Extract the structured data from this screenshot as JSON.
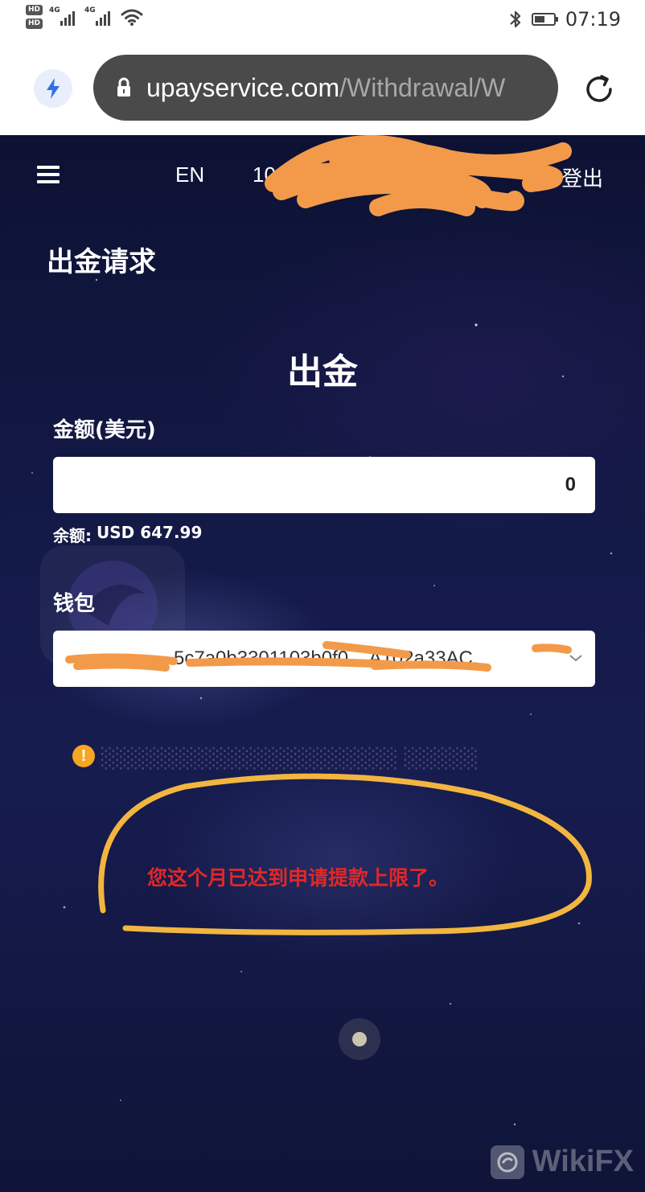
{
  "status_bar": {
    "badges": [
      "HD",
      "HD"
    ],
    "network_1": "4G",
    "network_2": "4G",
    "time": "07:19",
    "icons": [
      "bluetooth-icon",
      "battery-icon",
      "wifi-icon",
      "signal-icon"
    ],
    "battery_level": 0.55
  },
  "browser": {
    "url_domain": "upayservice.com",
    "url_path": "/Withdrawal/W",
    "icons": [
      "flash-icon",
      "lock-icon",
      "reload-icon"
    ]
  },
  "nav": {
    "language": "EN",
    "account_visible": "10",
    "logout_label": "登出",
    "icons": [
      "menu-icon",
      "power-icon"
    ]
  },
  "page": {
    "section_title": "出金请求",
    "form_title": "出金",
    "amount_label": "金额(美元)",
    "amount_value": "0",
    "balance_label": "余额:",
    "balance_value": "USD 647.99",
    "wallet_label": "钱包",
    "wallet_value": "5c7a0b3301103b0f0... A102a33AC.",
    "error_message": "您这个月已达到申请提款上限了。"
  },
  "watermark": {
    "brand": "WikiFX"
  },
  "colors": {
    "page_bg": "#141a48",
    "url_bar": "#4a4a4a",
    "error_red": "#e02828",
    "annotation_yellow": "#f2b640",
    "redaction_orange": "#f39a4a",
    "warning_orange": "#f5a623"
  }
}
